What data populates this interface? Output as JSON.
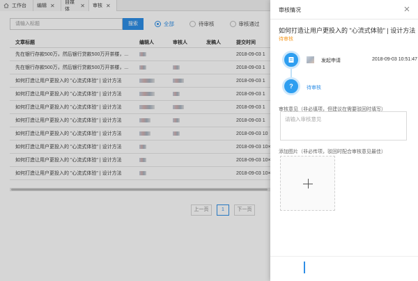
{
  "tabs": [
    {
      "label": "工作台",
      "close": ""
    },
    {
      "label": "编辑",
      "close": "✕"
    },
    {
      "label": "自媒体",
      "close": "✕"
    },
    {
      "label": "审核",
      "close": "✕"
    }
  ],
  "search": {
    "placeholder": "请输入标题",
    "button": "搜索"
  },
  "filters": [
    {
      "label": "全部",
      "selected": true
    },
    {
      "label": "待审核",
      "selected": false
    },
    {
      "label": "审核通过",
      "selected": false
    }
  ],
  "table": {
    "headers": {
      "title": "文章标题",
      "editor": "编辑人",
      "reviewer": "审核人",
      "publisher": "发稿人",
      "time": "提交时间"
    },
    "rows": [
      {
        "title": "先在银行存款500万，然后银行贷款500万开茶楼，...",
        "time": "2018-09-03 1"
      },
      {
        "title": "先在银行存款500万，然后银行贷款500万开茶楼，...",
        "time": "2018-09-03 1"
      },
      {
        "title": "如何打造让用户更投入的 \"心流式体验\" | 设计方法",
        "time": "2018-09-03 1"
      },
      {
        "title": "如何打造让用户更投入的 \"心流式体验\" | 设计方法",
        "time": "2018-09-03 1"
      },
      {
        "title": "如何打造让用户更投入的 \"心流式体验\" | 设计方法",
        "time": "2018-09-03 1"
      },
      {
        "title": "如何打造让用户更投入的 \"心流式体验\" | 设计方法",
        "time": "2018-09-03 1"
      },
      {
        "title": "如何打造让用户更投入的 \"心流式体验\" | 设计方法",
        "time": "2018-09-03 10"
      },
      {
        "title": "如何打造让用户更投入的 \"心流式体验\" | 设计方法",
        "time": "2018-09-03 10×"
      },
      {
        "title": "如何打造让用户更投入的 \"心流式体验\" | 设计方法",
        "time": "2018-09-03 10×"
      },
      {
        "title": "如何打造让用户更投入的 \"心流式体验\" | 设计方法",
        "time": "2018-09-03 10×"
      }
    ]
  },
  "pager": {
    "prev": "上一页",
    "page": "1",
    "next": "下一页"
  },
  "drawer": {
    "title": "审核情况",
    "article_title": "如何打造让用户更投入的 \"心流式体验\" | 设计方法",
    "status": "待审核",
    "flow": {
      "action": "发起申请",
      "time": "2018-09-03 10:51:47",
      "pending": "待审核",
      "pending_icon": "?"
    },
    "opinion_label": "审核意见（非必填项，但建议在需要驳回时填写）",
    "opinion_placeholder": "请输入审核意见",
    "image_label": "添加图片（非必传项，驳回时配合审核意见最佳）"
  },
  "colors": {
    "accent": "#2e8ee6",
    "pending": "#f59a23"
  }
}
